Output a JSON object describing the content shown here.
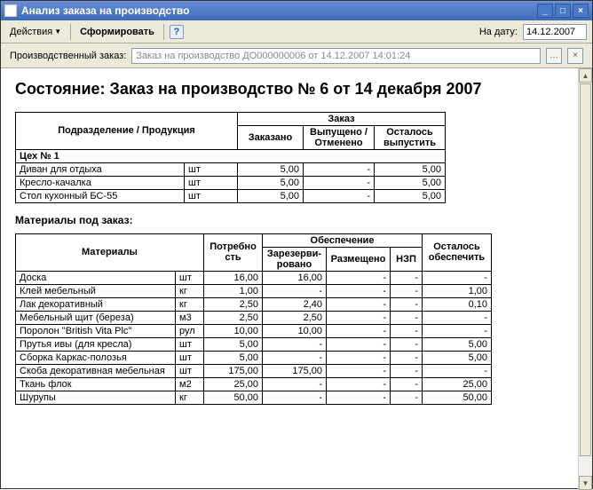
{
  "window": {
    "title": "Анализ заказа на производство"
  },
  "toolbar": {
    "actions": "Действия",
    "form": "Сформировать",
    "date_label": "На дату:",
    "date_value": "14.12.2007"
  },
  "filter": {
    "label": "Производственный заказ:",
    "value": "Заказ на производство ДО000000006 от 14.12.2007 14:01:24"
  },
  "report": {
    "heading": "Состояние: Заказ на производство № 6 от 14 декабря 2007",
    "t1": {
      "h_dept": "Подразделение / Продукция",
      "h_order": "Заказ",
      "h_ord": "Заказано",
      "h_rel": "Выпущено / Отменено",
      "h_rem": "Осталось выпустить",
      "group": "Цех № 1",
      "rows": [
        {
          "name": "Диван для отдыха",
          "unit": "шт",
          "ord": "5,00",
          "rel": "-",
          "rem": "5,00"
        },
        {
          "name": "Кресло-качалка",
          "unit": "шт",
          "ord": "5,00",
          "rel": "-",
          "rem": "5,00"
        },
        {
          "name": "Стол кухонный БС-55",
          "unit": "шт",
          "ord": "5,00",
          "rel": "-",
          "rem": "5,00"
        }
      ]
    },
    "materials_label": "Материалы под заказ:",
    "t2": {
      "h_mat": "Материалы",
      "h_need": "Потребно сть",
      "h_prov": "Обеспечение",
      "h_res": "Зарезерви-ровано",
      "h_pl": "Размещено",
      "h_nzp": "НЗП",
      "h_rem": "Осталось обеспечить",
      "rows": [
        {
          "name": "Доска",
          "unit": "шт",
          "need": "16,00",
          "res": "16,00",
          "pl": "-",
          "nzp": "-",
          "rem": "-"
        },
        {
          "name": "Клей мебельный",
          "unit": "кг",
          "need": "1,00",
          "res": "-",
          "pl": "-",
          "nzp": "-",
          "rem": "1,00"
        },
        {
          "name": "Лак декоративный",
          "unit": "кг",
          "need": "2,50",
          "res": "2,40",
          "pl": "-",
          "nzp": "-",
          "rem": "0,10"
        },
        {
          "name": "Мебельный щит (береза)",
          "unit": "м3",
          "need": "2,50",
          "res": "2,50",
          "pl": "-",
          "nzp": "-",
          "rem": "-"
        },
        {
          "name": "Поролон \"British Vita Plc\"",
          "unit": "рул",
          "need": "10,00",
          "res": "10,00",
          "pl": "-",
          "nzp": "-",
          "rem": "-"
        },
        {
          "name": "Прутья ивы (для кресла)",
          "unit": "шт",
          "need": "5,00",
          "res": "-",
          "pl": "-",
          "nzp": "-",
          "rem": "5,00"
        },
        {
          "name": "Сборка Каркас-полозья",
          "unit": "шт",
          "need": "5,00",
          "res": "-",
          "pl": "-",
          "nzp": "-",
          "rem": "5,00"
        },
        {
          "name": "Скоба декоративная мебельная",
          "unit": "шт",
          "need": "175,00",
          "res": "175,00",
          "pl": "-",
          "nzp": "-",
          "rem": "-"
        },
        {
          "name": "Ткань флок",
          "unit": "м2",
          "need": "25,00",
          "res": "-",
          "pl": "-",
          "nzp": "-",
          "rem": "25,00"
        },
        {
          "name": "Шурупы",
          "unit": "кг",
          "need": "50,00",
          "res": "-",
          "pl": "-",
          "nzp": "-",
          "rem": "50,00"
        }
      ]
    }
  }
}
